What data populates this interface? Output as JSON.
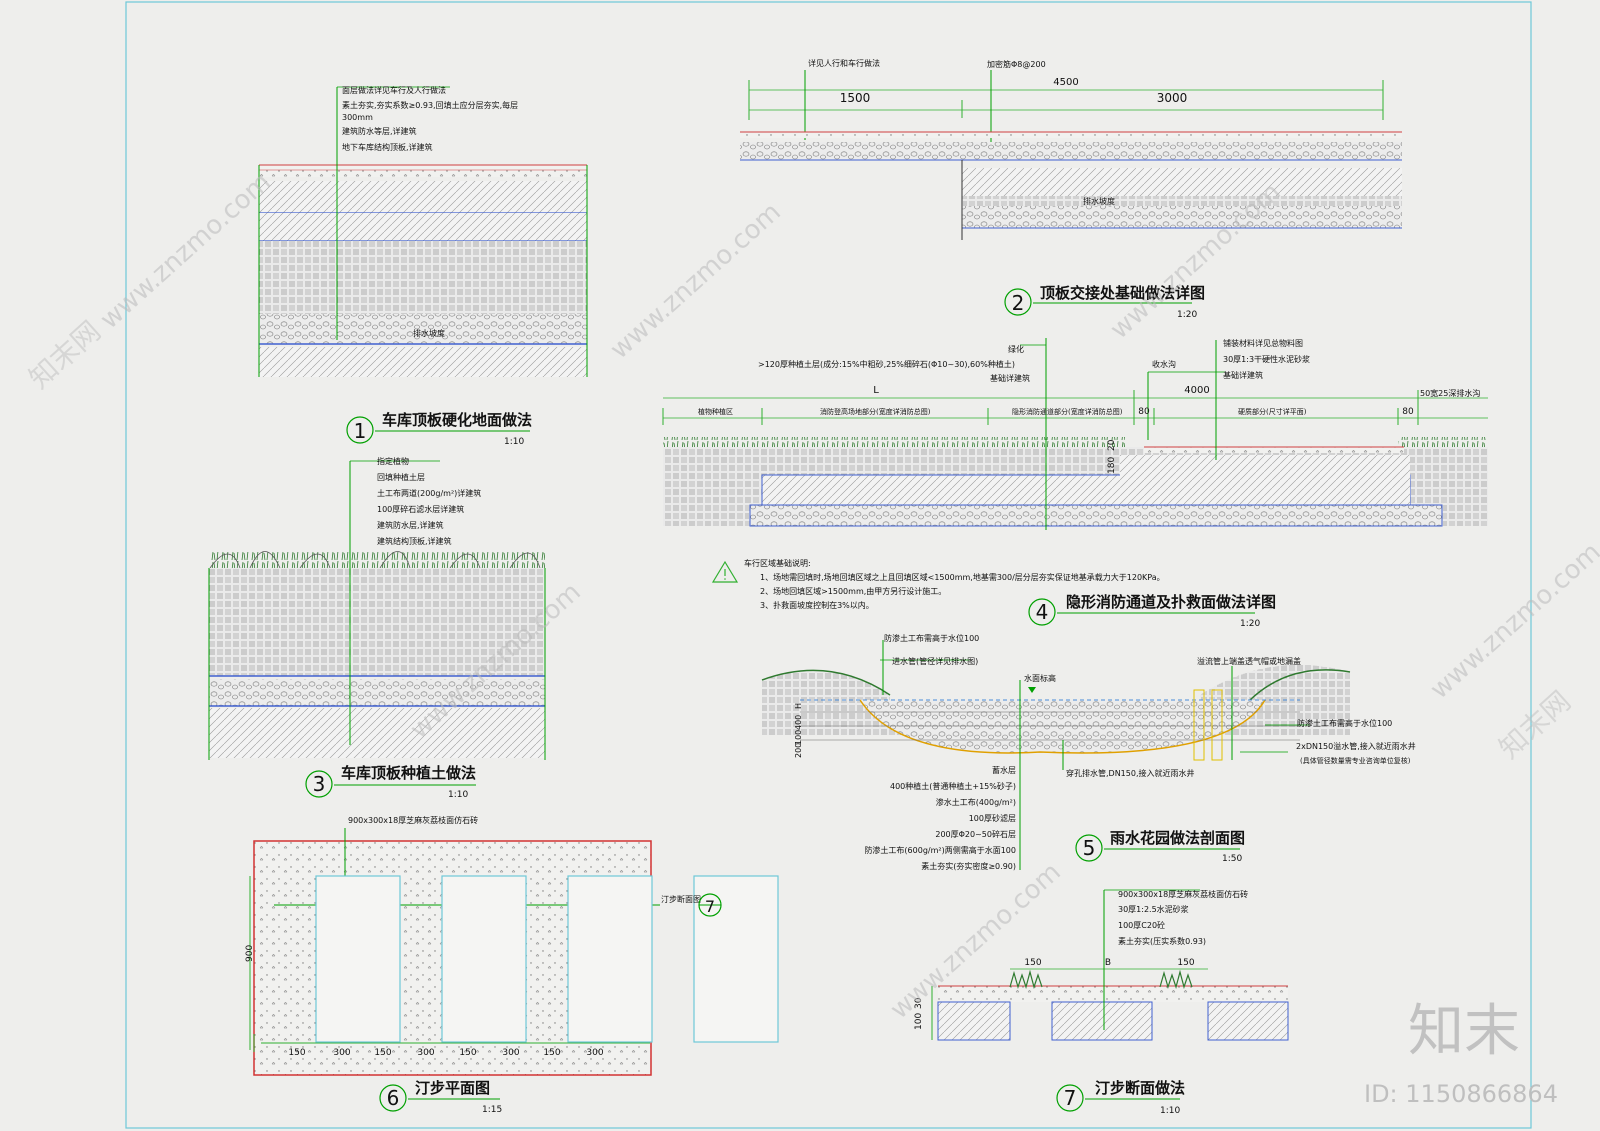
{
  "colors": {
    "background": "#eeeeec",
    "frame": "#6ec8d8",
    "annotation": "#00a000",
    "dimension": "#30b030",
    "border_red": "#d23232",
    "hatch_blue": "#4060d0",
    "layer_red": "#d04040",
    "fill_gray": "#d8d8d8"
  },
  "drawings": {
    "d1": {
      "num": "1",
      "title": "车库顶板硬化地面做法",
      "scale": "1:10",
      "notes": [
        "面层做法详见车行及人行做法",
        "素土夯实,夯实系数≥0.93,回填土应分层夯实,每层",
        "300mm",
        "建筑防水等层,详建筑",
        "地下车库结构顶板,详建筑"
      ],
      "inner_label": "排水坡度"
    },
    "d2": {
      "num": "2",
      "title": "顶板交接处基础做法详图",
      "scale": "1:20",
      "top_labels": [
        "详见人行和车行做法",
        "加密筋Φ8@200"
      ],
      "dims": [
        "4500",
        "1500",
        "3000"
      ],
      "inner_label": "排水坡度"
    },
    "d3": {
      "num": "3",
      "title": "车库顶板种植土做法",
      "scale": "1:10",
      "notes": [
        "指定植物",
        "回填种植土层",
        "土工布两道(200g/m²)详建筑",
        "100厚碎石滤水层详建筑",
        "建筑防水层,详建筑",
        "建筑结构顶板,详建筑"
      ]
    },
    "d4": {
      "num": "4",
      "title": "隐形消防通道及扑救面做法详图",
      "scale": "1:20",
      "left_notes": [
        "绿化",
        ">120厚种植土层(成分:15%中粗砂,25%细碎石(Φ10~30),60%种植土)",
        "基础详建筑"
      ],
      "right_notes": [
        "铺装材料详见总物料图",
        "30厚1:3干硬性水泥砂浆",
        "基础详建筑"
      ],
      "top_dims": [
        "L",
        "4000",
        "50宽25深排水沟"
      ],
      "drain_label": "收水沟",
      "zones": [
        "植物种植区",
        "消防登高场地部分(宽度详消防总图)",
        "隐形消防通道部分(宽度详消防总图)",
        "80",
        "硬质部分(尺寸详平面)",
        "80"
      ],
      "side_dims": [
        "20",
        "180"
      ],
      "notes_title": "车行区域基础说明:",
      "notes": [
        "1、场地需回填时,场地回填区域之上且回填区域<1500mm,地基需300/层分层夯实保证地基承载力大于120KPa。",
        "2、场地回填区域>1500mm,由甲方另行设计施工。",
        "3、扑救面坡度控制在3%以内。"
      ]
    },
    "d5": {
      "num": "5",
      "title": "雨水花园做法剖面图",
      "scale": "1:50",
      "top_labels": [
        "防渗土工布需高于水位100",
        "进水管(管径详见排水图)",
        "水面标高",
        "溢流管上端盖透气帽或地漏盖"
      ],
      "right_labels": [
        "防渗土工布需高于水位100",
        "2xDN150溢水管,接入就近雨水井",
        "(具体管径数量需专业咨询单位复核)"
      ],
      "side_dims": [
        "H",
        "400",
        "100",
        "200"
      ],
      "pipe_label": "穿孔排水管,DN150,接入就近雨水井",
      "layers": [
        "蓄水层",
        "400种植土(普通种植土+15%砂子)",
        "渗水土工布(400g/m²)",
        "100厚砂滤层",
        "200厚Φ20~50碎石层",
        "防渗土工布(600g/m²)两侧需高于水面100",
        "素土夯实(夯实密度≥0.90)"
      ]
    },
    "d6": {
      "num": "6",
      "title": "汀步平面图",
      "scale": "1:15",
      "top_label": "900x300x18厚芝麻灰荔枝面仿石砖",
      "section_label": "汀步断面图",
      "section_num": "7",
      "height_dim": "900",
      "dims": [
        "150",
        "300",
        "150",
        "300",
        "150",
        "300",
        "150",
        "300"
      ]
    },
    "d7": {
      "num": "7",
      "title": "汀步断面做法",
      "scale": "1:10",
      "notes": [
        "900x300x18厚芝麻灰荔枝面仿石砖",
        "30厚1:2.5水泥砂浆",
        "100厚C20砼",
        "素土夯实(压实系数0.93)"
      ],
      "dims": [
        "150",
        "B",
        "150"
      ],
      "side_dims": [
        "30",
        "100"
      ]
    }
  },
  "watermark": {
    "site": "www.znzmo.com",
    "brand": "知末网",
    "logo": "知末",
    "id_text": "ID: 1150866864"
  }
}
